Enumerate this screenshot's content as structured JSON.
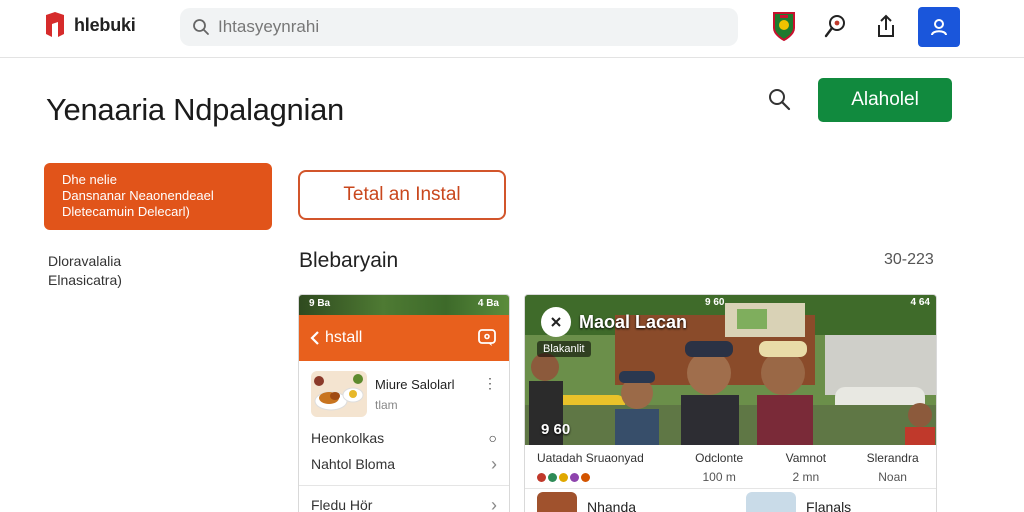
{
  "app": {
    "name": "hlebuki",
    "search_placeholder": "Ihtasyeynrahi"
  },
  "header": {
    "title": "Yenaaria Ndpalagnian",
    "action_label": "Alaholel"
  },
  "promo": {
    "line1": "Dhe nelie",
    "line2": "Dansnanar Neaonendeael",
    "line3": "Dletecamuin Delecarl)"
  },
  "side_note": {
    "line1": "Dloravalalia",
    "line2": "Elnasicatra)"
  },
  "install_button": "Tetal an Instal",
  "section": {
    "title": "Blebaryain",
    "meta": "30-223"
  },
  "phone": {
    "status_left": "9 Ba",
    "status_right": "4 Ba",
    "bar_title": "hstall",
    "item_title": "Miure Salolarl",
    "item_sub": "tlam",
    "rows": [
      {
        "label": "Heonkolkas",
        "indicator": "○"
      },
      {
        "label": "Nahtol Bloma",
        "indicator": "›"
      },
      {
        "label": "Fledu Hör",
        "indicator": "›"
      }
    ]
  },
  "media": {
    "status_left": "9 60",
    "status_right": "4 64",
    "overlay_title": "Maoal Lacan",
    "overlay_tag": "Blakanlit",
    "overlay_count": "9 60",
    "stats": [
      {
        "label": "Uatadah Sruaonyad",
        "value": "",
        "dots": [
          "#c0392b",
          "#2e8b57",
          "#e0a800",
          "#8e44ad",
          "#d35400"
        ]
      },
      {
        "label": "Odclonte",
        "value": "100 m"
      },
      {
        "label": "Vamnot",
        "value": "2 mn"
      },
      {
        "label": "Slerandra",
        "value": "Noan"
      }
    ],
    "next_label": "Nhanda",
    "next_label2": "Flanals"
  },
  "colors": {
    "accent_orange": "#e8601d",
    "promo_orange": "#e1541a",
    "action_green": "#118a3e",
    "user_blue": "#1a56db"
  }
}
